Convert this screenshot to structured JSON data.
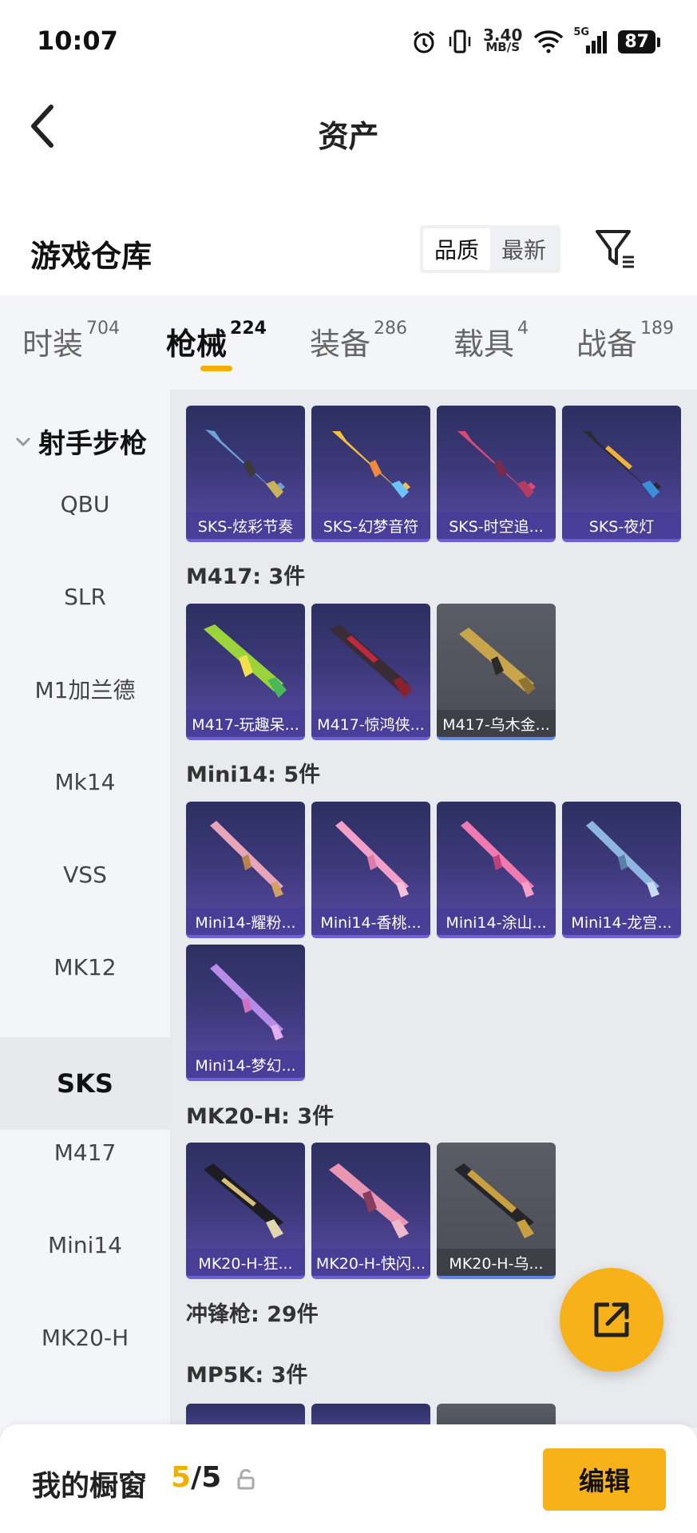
{
  "status_bar": {
    "time": "10:07",
    "speed_value": "3.40",
    "speed_unit": "MB/S",
    "network": "5G",
    "battery": "87"
  },
  "header": {
    "title": "资产",
    "back_icon": "chevron-left-icon"
  },
  "warehouse": {
    "title": "游戏仓库",
    "sort_options": [
      "品质",
      "最新"
    ],
    "sort_selected": "品质",
    "filter_icon": "filter-icon"
  },
  "tabs": [
    {
      "label": "时装",
      "count": "704"
    },
    {
      "label": "枪械",
      "count": "224",
      "active": true
    },
    {
      "label": "装备",
      "count": "286"
    },
    {
      "label": "载具",
      "count": "4"
    },
    {
      "label": "战备",
      "count": "189"
    }
  ],
  "sidebar": {
    "category": "射手步枪",
    "items": [
      "QBU",
      "SLR",
      "M1加兰德",
      "Mk14",
      "VSS",
      "MK12",
      "SKS",
      "M417",
      "Mini14",
      "MK20-H"
    ],
    "active": "SKS"
  },
  "content": {
    "sks_row": [
      "SKS-炫彩节奏",
      "SKS-幻梦音符",
      "SKS-时空追...",
      "SKS-夜灯"
    ],
    "m417_title": "M417: 3件",
    "m417_row": [
      "M417-玩趣呆...",
      "M417-惊鸿侠...",
      "M417-乌木金..."
    ],
    "mini14_title": "Mini14: 5件",
    "mini14_row1": [
      "Mini14-耀粉...",
      "Mini14-香桃...",
      "Mini14-涂山...",
      "Mini14-龙宫..."
    ],
    "mini14_row2": [
      "Mini14-梦幻..."
    ],
    "mk20_title": "MK20-H: 3件",
    "mk20_row": [
      "MK20-H-狂...",
      "MK20-H-快闪...",
      "MK20-H-乌..."
    ],
    "smg_title": "冲锋枪: 29件",
    "mp5k_title": "MP5K: 3件"
  },
  "colors": {
    "accent": "#f7b219",
    "card_purple": "#3b3878",
    "card_gray": "#4a4d55"
  },
  "bottom_bar": {
    "title": "我的橱窗",
    "used": "5",
    "separator": "/",
    "total": "5",
    "edit_label": "编辑"
  },
  "fab": {
    "icon": "share-external-icon"
  }
}
